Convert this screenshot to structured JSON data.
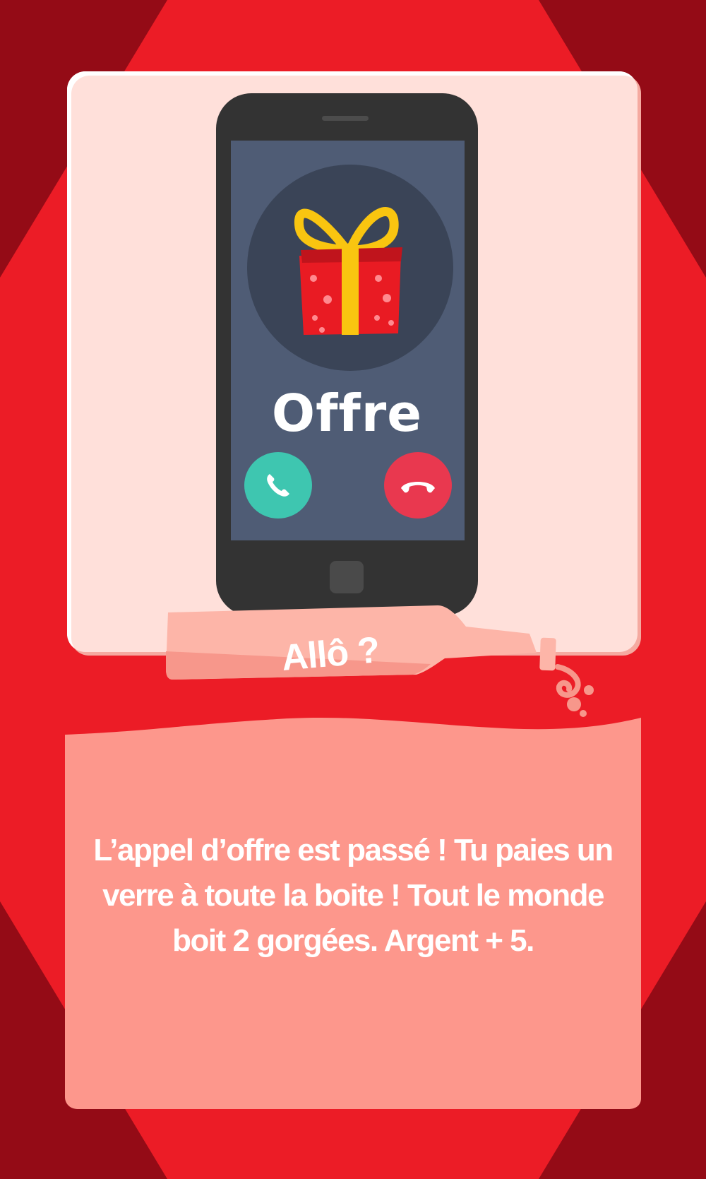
{
  "caller": {
    "name": "Offre",
    "accept_icon": "phone-accept-icon",
    "decline_icon": "phone-decline-icon",
    "avatar_icon": "gift-icon"
  },
  "bottle": {
    "label": "Allô ?"
  },
  "card": {
    "text": "L’appel d’offre est passé ! Tu paies un verre à toute la boite ! Tout le monde boit 2 gorgées. Argent + 5."
  },
  "colors": {
    "background_dark": "#940b16",
    "background_red": "#ec1c26",
    "panel_light": "#ffe0da",
    "panel_salmon": "#fd978c",
    "phone_body": "#333333",
    "phone_screen": "#4f5c75",
    "accept": "#3ec6b0",
    "decline": "#e9384f",
    "gift_red": "#e91b23",
    "ribbon_yellow": "#f9c510"
  }
}
